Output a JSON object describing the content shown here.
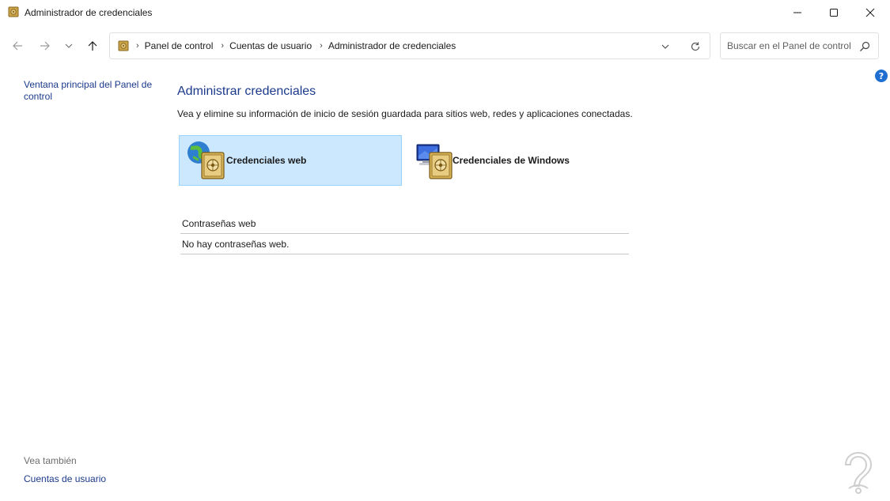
{
  "window": {
    "title": "Administrador de credenciales"
  },
  "nav": {
    "breadcrumbs": [
      "Panel de control",
      "Cuentas de usuario",
      "Administrador de credenciales"
    ],
    "search_placeholder": "Buscar en el Panel de control"
  },
  "left_pane": {
    "home_link": "Ventana principal del Panel de control",
    "see_also_label": "Vea también",
    "see_also_link": "Cuentas de usuario"
  },
  "main": {
    "title": "Administrar credenciales",
    "description": "Vea y elimine su información de inicio de sesión guardada para sitios web, redes y aplicaciones conectadas.",
    "tiles": [
      {
        "label": "Credenciales web",
        "icon": "web-credentials-icon",
        "selected": true
      },
      {
        "label": "Credenciales de Windows",
        "icon": "windows-credentials-icon",
        "selected": false
      }
    ],
    "section_title": "Contraseñas web",
    "empty_message": "No hay contraseñas web."
  },
  "help": {
    "symbol": "?"
  },
  "colors": {
    "link": "#1b3a8c",
    "selected_tile_bg": "#cce8ff",
    "selected_tile_border": "#99d1ff",
    "help_badge": "#1f6fd1"
  }
}
